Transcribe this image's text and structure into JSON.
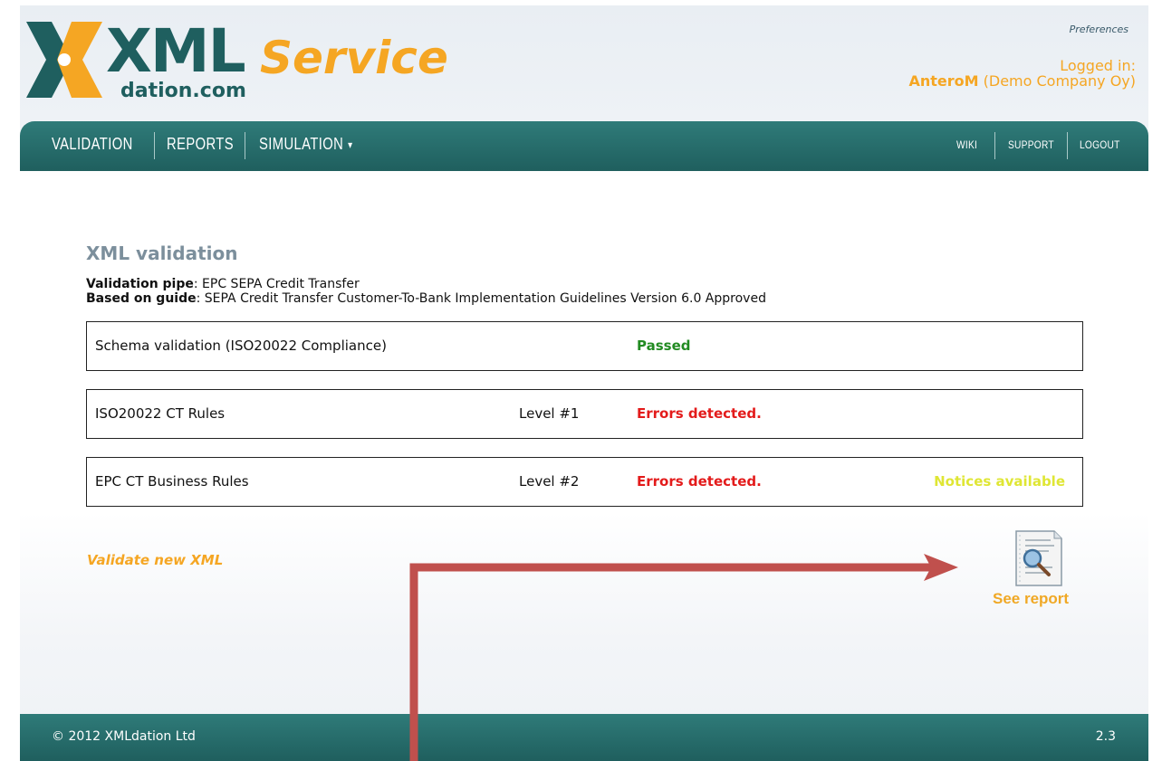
{
  "brand": {
    "name": "XML",
    "product": "Service",
    "domain": "dation.com",
    "accent": "#f5a623",
    "primary": "#1f5f5f"
  },
  "header": {
    "preferences_label": "Preferences",
    "logged_in_label": "Logged in:",
    "user": "AnteroM",
    "company": "(Demo Company Oy)"
  },
  "nav": {
    "items": [
      "VALIDATION",
      "REPORTS",
      "SIMULATION"
    ],
    "right_items": [
      "WIKI",
      "SUPPORT",
      "LOGOUT"
    ]
  },
  "main": {
    "title": "XML validation",
    "pipe_label": "Validation pipe",
    "pipe_value": ": EPC SEPA Credit Transfer",
    "guide_label": "Based on guide",
    "guide_value": ": SEPA Credit Transfer Customer-To-Bank Implementation Guidelines Version 6.0 Approved",
    "results": [
      {
        "name": "Schema validation (ISO20022 Compliance)",
        "level": "",
        "status": "Passed",
        "notice": ""
      },
      {
        "name": "ISO20022 CT Rules",
        "level": "Level #1",
        "status": "Errors detected.",
        "notice": ""
      },
      {
        "name": "EPC CT Business Rules",
        "level": "Level #2",
        "status": "Errors detected.",
        "notice": "Notices available"
      }
    ],
    "validate_new_label": "Validate new XML",
    "see_report_label": "See report"
  },
  "footer": {
    "copyright": "© 2012 XMLdation Ltd",
    "version": "2.3"
  },
  "colors": {
    "passed": "#228b22",
    "error": "#e31b1b",
    "notice": "#dfe634",
    "nav_bg": "#2a706f",
    "arrow": "#c0504d"
  },
  "icons": {
    "logo": "xmldation-logo-icon",
    "report": "report-document-magnifier-icon",
    "dropdown": "caret-down-icon",
    "annotation": "red-arrow-icon"
  }
}
